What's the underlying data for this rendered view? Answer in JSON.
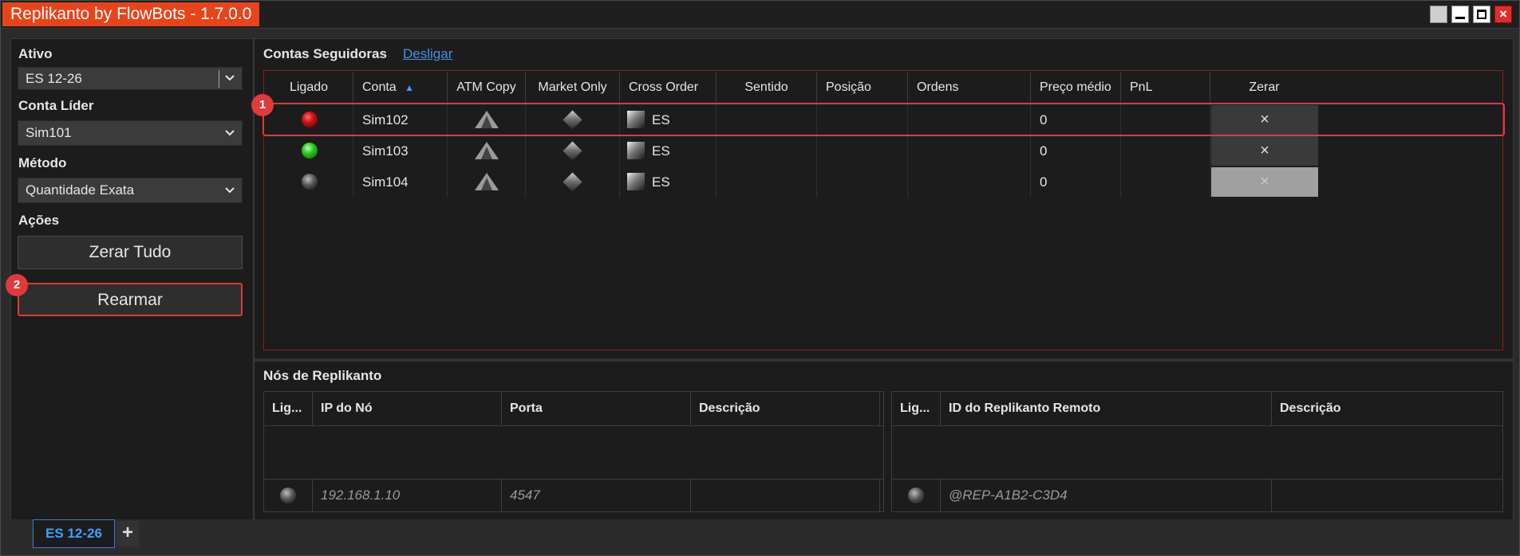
{
  "window": {
    "title": "Replikanto by FlowBots - 1.7.0.0"
  },
  "left_panel": {
    "ativo_label": "Ativo",
    "ativo_value": "ES 12-26",
    "conta_lider_label": "Conta Líder",
    "conta_lider_value": "Sim101",
    "metodo_label": "Método",
    "metodo_value": "Quantidade Exata",
    "acoes_label": "Ações",
    "zerar_tudo": "Zerar Tudo",
    "rearmar": "Rearmar"
  },
  "followers": {
    "title": "Contas Seguidoras",
    "disconnect_link": "Desligar",
    "columns": [
      "Ligado",
      "Conta",
      "ATM Copy",
      "Market Only",
      "Cross Order",
      "Sentido",
      "Posição",
      "Ordens",
      "Preço médio",
      "PnL",
      "Zerar"
    ],
    "sort_indicator": "▲",
    "rows": [
      {
        "account": "Sim102",
        "status": "red",
        "cross": "ES",
        "avg_price": "0",
        "zerar": "×",
        "zerar_enabled": true
      },
      {
        "account": "Sim103",
        "status": "green",
        "cross": "ES",
        "avg_price": "0",
        "zerar": "×",
        "zerar_enabled": true
      },
      {
        "account": "Sim104",
        "status": "grey",
        "cross": "ES",
        "avg_price": "0",
        "zerar": "×",
        "zerar_enabled": false
      }
    ]
  },
  "callouts": [
    "1",
    "2"
  ],
  "nodes": {
    "title": "Nós de Replikanto",
    "local_columns": [
      "Lig...",
      "IP do Nó",
      "Porta",
      "Descrição"
    ],
    "local_row": {
      "ip": "192.168.1.10",
      "port": "4547",
      "description": ""
    },
    "remote_columns": [
      "Lig...",
      "ID do Replikanto Remoto",
      "Descrição"
    ],
    "remote_row": {
      "id": "@REP-A1B2-C3D4",
      "description": ""
    }
  },
  "tabs": {
    "active": "ES 12-26",
    "add": "+"
  },
  "icons": {
    "status": "status-led-icon",
    "atm": "triangle-icon",
    "market": "diamond-icon",
    "cross": "square-icon",
    "close": "close-x-icon"
  }
}
